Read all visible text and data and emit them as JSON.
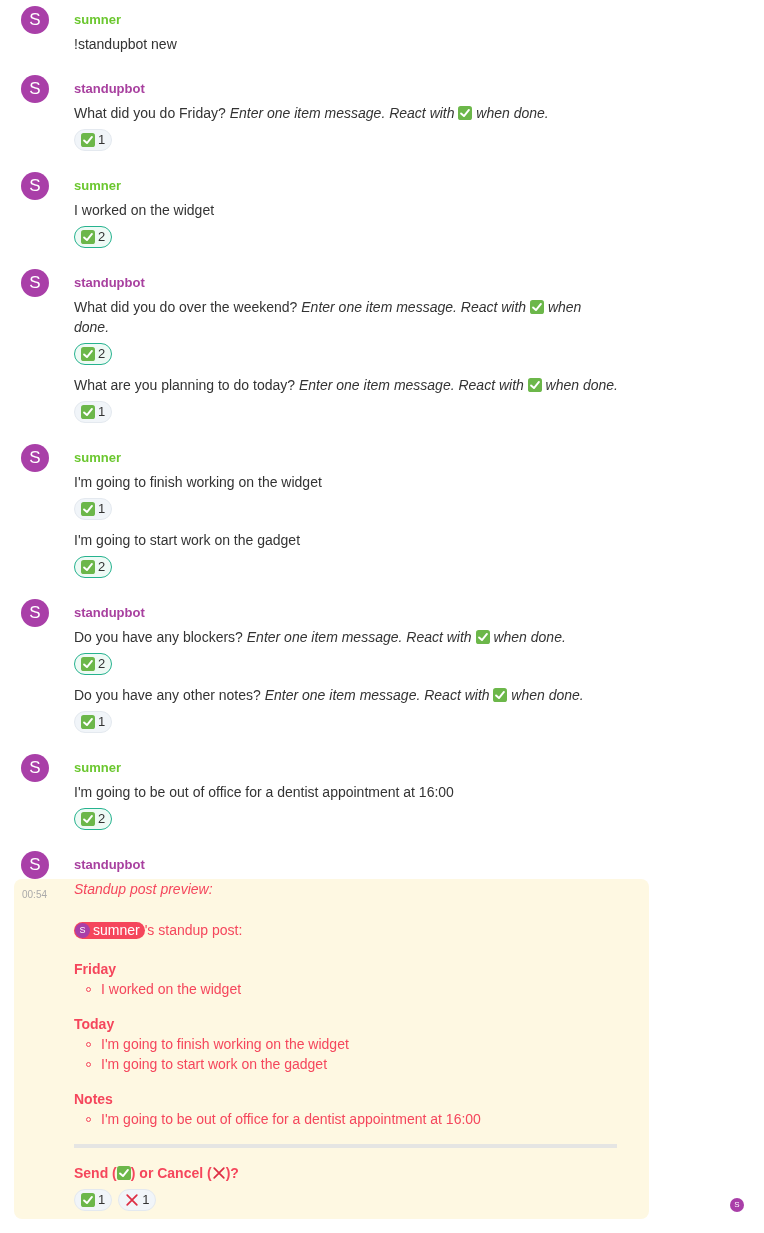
{
  "messages": [
    {
      "author": "sumner",
      "kind": "user",
      "avatar": "S",
      "bodies": [
        {
          "text": "!standupbot new"
        }
      ]
    },
    {
      "author": "standupbot",
      "kind": "bot",
      "avatar": "S",
      "bodies": [
        {
          "question": "What did you do Friday?",
          "hint_before": "Enter one item message. React with",
          "hint_after": "when done.",
          "reactions": [
            {
              "kind": "check",
              "count": "1",
              "selected": false
            }
          ]
        }
      ]
    },
    {
      "author": "sumner",
      "kind": "user",
      "avatar": "S",
      "bodies": [
        {
          "text": "I worked on the widget",
          "reactions": [
            {
              "kind": "check",
              "count": "2",
              "selected": true
            }
          ]
        }
      ]
    },
    {
      "author": "standupbot",
      "kind": "bot",
      "avatar": "S",
      "bodies": [
        {
          "question": "What did you do over the weekend?",
          "hint_before": "Enter one item message. React with",
          "hint_after": "when done.",
          "reactions": [
            {
              "kind": "check",
              "count": "2",
              "selected": true
            }
          ]
        },
        {
          "question": "What are you planning to do today?",
          "hint_before": "Enter one item message. React with",
          "hint_after": "when done.",
          "reactions": [
            {
              "kind": "check",
              "count": "1",
              "selected": false
            }
          ]
        }
      ]
    },
    {
      "author": "sumner",
      "kind": "user",
      "avatar": "S",
      "bodies": [
        {
          "text": "I'm going to finish working on the widget",
          "reactions": [
            {
              "kind": "check",
              "count": "1",
              "selected": false
            }
          ]
        },
        {
          "text": "I'm going to start work on the gadget",
          "reactions": [
            {
              "kind": "check",
              "count": "2",
              "selected": true
            }
          ]
        }
      ]
    },
    {
      "author": "standupbot",
      "kind": "bot",
      "avatar": "S",
      "bodies": [
        {
          "question": "Do you have any blockers?",
          "hint_before": "Enter one item message. React with",
          "hint_after": "when done.",
          "reactions": [
            {
              "kind": "check",
              "count": "2",
              "selected": true
            }
          ]
        },
        {
          "question": "Do you have any other notes?",
          "hint_before": "Enter one item message. React with",
          "hint_after": "when done.",
          "reactions": [
            {
              "kind": "check",
              "count": "1",
              "selected": false
            }
          ]
        }
      ]
    },
    {
      "author": "sumner",
      "kind": "user",
      "avatar": "S",
      "bodies": [
        {
          "text": "I'm going to be out of office for a dentist appointment at 16:00",
          "reactions": [
            {
              "kind": "check",
              "count": "2",
              "selected": true
            }
          ]
        }
      ]
    }
  ],
  "preview": {
    "author": "standupbot",
    "kind": "bot",
    "avatar": "S",
    "time": "00:54",
    "title": "Standup post preview:",
    "mention": {
      "avatar": "S",
      "name": "sumner"
    },
    "mention_suffix": "'s standup post:",
    "sections": [
      {
        "heading": "Friday",
        "items": [
          "I worked on the widget"
        ]
      },
      {
        "heading": "Today",
        "items": [
          "I'm going to finish working on the widget",
          "I'm going to start work on the gadget"
        ]
      },
      {
        "heading": "Notes",
        "items": [
          "I'm going to be out of office for a dentist appointment at 16:00"
        ]
      }
    ],
    "prompt": {
      "send": "Send (",
      "middle": ") or Cancel (",
      "end": ")?"
    },
    "reactions": [
      {
        "kind": "check",
        "count": "1",
        "selected": false
      },
      {
        "kind": "cross",
        "count": "1",
        "selected": false
      }
    ]
  },
  "read_receipt": {
    "avatar": "S"
  }
}
